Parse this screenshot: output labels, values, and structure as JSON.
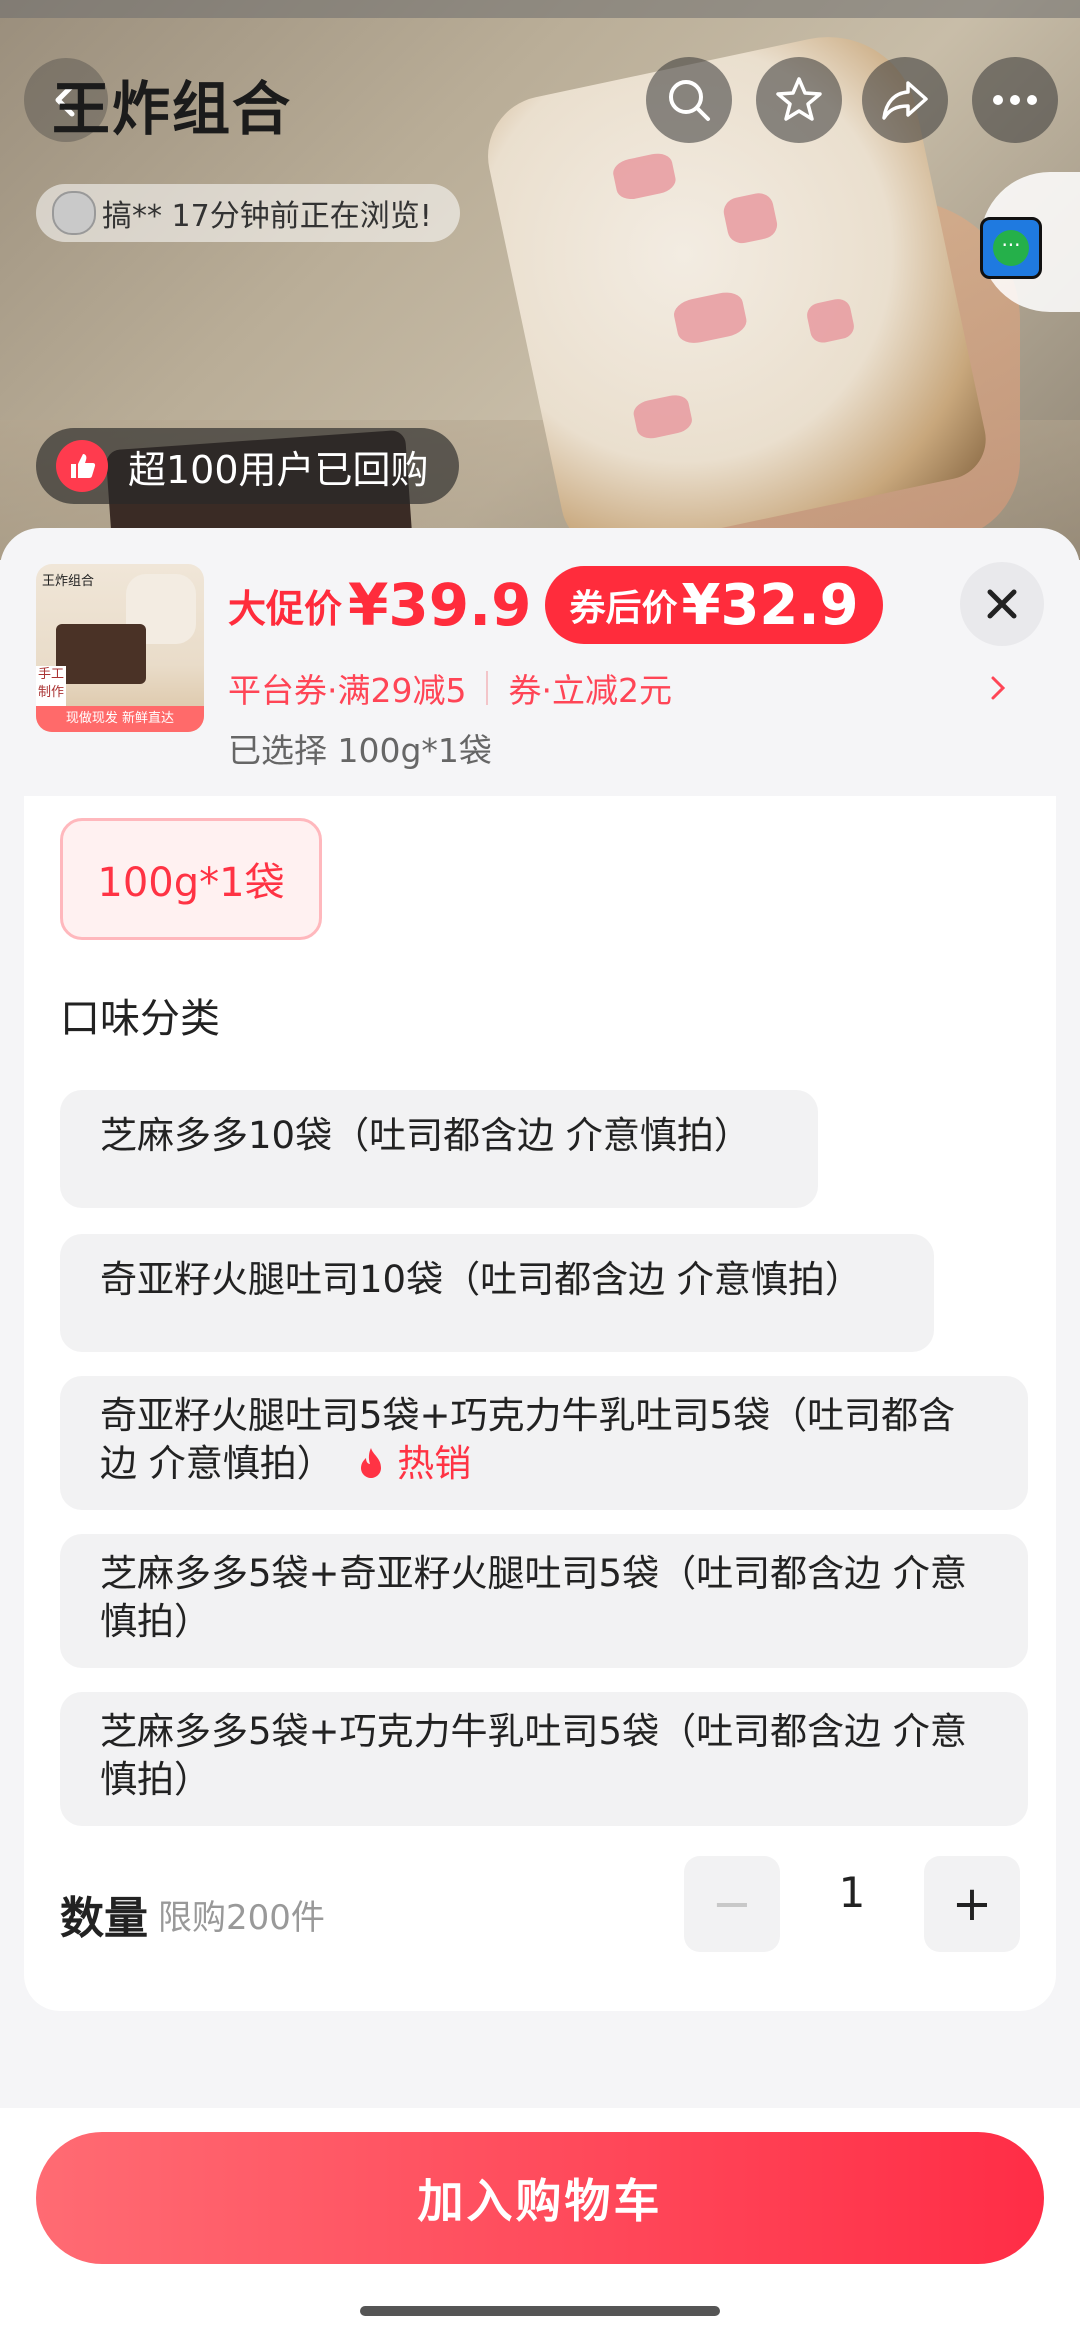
{
  "header": {
    "title": "王炸组合",
    "viewer_text": "搞** 17分钟前正在浏览!",
    "repurchase_text": "超100用户已回购"
  },
  "product": {
    "image_brand": "王炸组合",
    "image_tag": "现做现发 新鲜直达",
    "image_handmade": "手工制作",
    "promo_label": "大促价",
    "promo_price": "¥39.9",
    "coupon_label": "券后价",
    "coupon_price": "¥32.9",
    "coupon_1": "平台券·满29减5",
    "coupon_2": "券·立减2元",
    "selected": "已选择 100g*1袋"
  },
  "spec": {
    "selected_option": "100g*1袋"
  },
  "flavor": {
    "title": "口味分类",
    "options": [
      "芝麻多多10袋（吐司都含边 介意慎拍）",
      "奇亚籽火腿吐司10袋（吐司都含边 介意慎拍）",
      "奇亚籽火腿吐司5袋+巧克力牛乳吐司5袋（吐司都含边 介意慎拍）",
      "芝麻多多5袋+奇亚籽火腿吐司5袋（吐司都含边 介意慎拍）",
      "芝麻多多5袋+巧克力牛乳吐司5袋（吐司都含边 介意慎拍）"
    ],
    "hot_label": "热销"
  },
  "quantity": {
    "label": "数量",
    "limit": "限购200件",
    "value": "1",
    "minus": "−",
    "plus": "+"
  },
  "footer": {
    "cart_button": "加入购物车"
  },
  "colors": {
    "accent": "#ff2c3c",
    "cart_gradient_start": "#ff6b73",
    "cart_gradient_end": "#ff2d46"
  }
}
